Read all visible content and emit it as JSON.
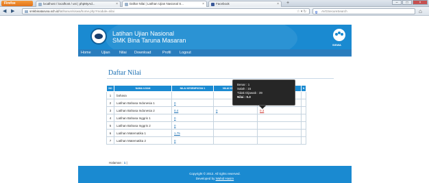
{
  "browser": {
    "menu_button": "Firefox",
    "tabs": [
      {
        "label": "localhost / localhost / uni | phpMyAd..."
      },
      {
        "label": "Daftar Nilai | Latihan Ujian Nasional S..."
      },
      {
        "label": "Facebook"
      }
    ],
    "new_tab": "+",
    "url_host": "smkbinataruna.sch.id",
    "url_path": "/latihanun/siswa/home.php?module=nilai",
    "search_placeholder": "AVGSecureSearch"
  },
  "site": {
    "title_line1": "Latihan Ujian Nasional",
    "title_line2": "SMK Bina Taruna Masaran",
    "user_label": "SISWA",
    "menu": [
      "Home",
      "Ujian",
      "Nilai",
      "Download",
      "Profil",
      "Logout"
    ],
    "page_heading": "Daftar Nilai"
  },
  "table": {
    "headers": [
      "NO",
      "NAMA UJIAN",
      "NILAI KESEMPATAN 1",
      "NILAI KESEMPATAN 2",
      "NILAI KESEMPATAN 3",
      "N"
    ],
    "rows": [
      {
        "no": "1",
        "name": "bahasa",
        "n1": "",
        "n2": "",
        "n3": ""
      },
      {
        "no": "2",
        "name": "Latihan Bahasa Indonesia 1",
        "n1": "0",
        "n2": "",
        "n3": ""
      },
      {
        "no": "3",
        "name": "Latihan Bahasa Indonesia 2",
        "n1": "0.4",
        "n2": "0",
        "n3": "0.3"
      },
      {
        "no": "4",
        "name": "Latihan Bahasa Inggris 1",
        "n1": "0",
        "n2": "",
        "n3": ""
      },
      {
        "no": "5",
        "name": "Latihan Bahasa Inggris 2",
        "n1": "0",
        "n2": "",
        "n3": ""
      },
      {
        "no": "6",
        "name": "Latihan Matematika 1",
        "n1": "1.75",
        "n2": "",
        "n3": ""
      },
      {
        "no": "7",
        "name": "Latihan Matematika 2",
        "n1": "0",
        "n2": "",
        "n3": ""
      }
    ]
  },
  "pagination": {
    "label": "Halaman :",
    "current": "1"
  },
  "tooltip": {
    "benar": "Benar : 1",
    "salah": "Salah : 15",
    "tidak": "Tidak Dijawab : 39",
    "nilai": "Nilai : 0.3"
  },
  "footer": {
    "copyright": "Copyright © 2012. All rights reserved.",
    "developed_prefix": "Developed by",
    "developer": "Wahid Hasim"
  }
}
